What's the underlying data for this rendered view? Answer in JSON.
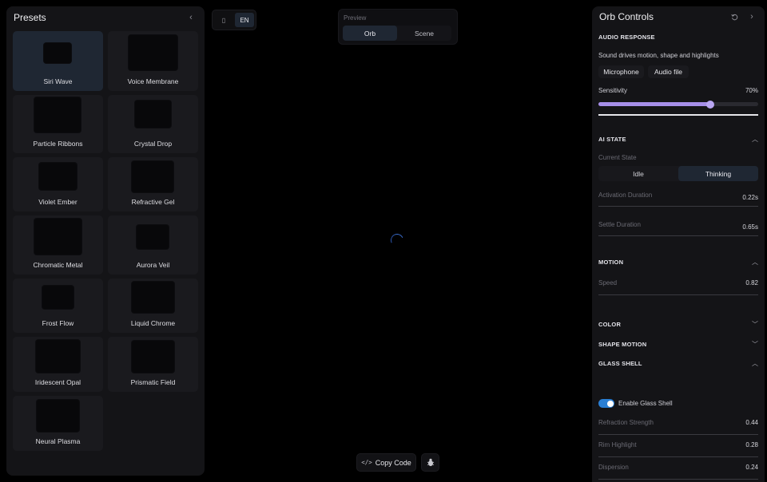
{
  "presets": {
    "title": "Presets",
    "collapse_icon": "chevron-left-icon",
    "items": [
      {
        "label": "Siri Wave"
      },
      {
        "label": "Voice Membrane"
      },
      {
        "label": "Particle Ribbons"
      },
      {
        "label": "Crystal Drop"
      },
      {
        "label": "Violet Ember"
      },
      {
        "label": "Refractive Gel"
      },
      {
        "label": "Chromatic Metal"
      },
      {
        "label": "Aurora Veil"
      },
      {
        "label": "Frost Flow"
      },
      {
        "label": "Liquid Chrome"
      },
      {
        "label": "Iridescent Opal"
      },
      {
        "label": "Prismatic Field"
      },
      {
        "label": "Neural Plasma"
      }
    ],
    "active": "Siri Wave"
  },
  "top_toggle": {
    "icon": "device-icon",
    "language": "EN"
  },
  "preview": {
    "label": "Preview",
    "tabs": [
      "Orb",
      "Scene"
    ],
    "active": "Orb"
  },
  "canvas": {
    "loading_icon": "spinner-icon"
  },
  "footer": {
    "copy_label": "Copy Code",
    "copy_icon": "code-icon",
    "bug_icon": "bug-icon"
  },
  "controls": {
    "title": "Orb Controls",
    "reset_icon": "reset-icon",
    "collapse_icon": "chevron-right-icon",
    "audio": {
      "title": "AUDIO RESPONSE",
      "description": "Sound drives motion, shape and highlights",
      "sources": [
        "Microphone",
        "Audio file"
      ],
      "sensitivity_label": "Sensitivity",
      "sensitivity_value": "70%",
      "sensitivity_fraction": 0.7
    },
    "ai_state": {
      "title": "AI STATE",
      "current_state_label": "Current State",
      "states": [
        "Idle",
        "Thinking"
      ],
      "active": "Thinking",
      "activation_label": "Activation Duration",
      "activation_value": "0.22s",
      "settle_label": "Settle Duration",
      "settle_value": "0.65s"
    },
    "motion": {
      "title": "MOTION",
      "speed_label": "Speed",
      "speed_value": "0.82"
    },
    "color": {
      "title": "COLOR"
    },
    "shape_motion": {
      "title": "SHAPE MOTION"
    },
    "glass_shell": {
      "title": "GLASS SHELL",
      "enable_label": "Enable Glass Shell",
      "enabled": true,
      "refraction_label": "Refraction Strength",
      "refraction_value": "0.44",
      "rim_label": "Rim Highlight",
      "rim_value": "0.28",
      "dispersion_label": "Dispersion",
      "dispersion_value": "0.24"
    }
  },
  "colors": {
    "accent": "#a58ee8",
    "toggle_on": "#2a7fd4",
    "active_bg": "#1f2733",
    "spinner": "#3b6fd0"
  }
}
